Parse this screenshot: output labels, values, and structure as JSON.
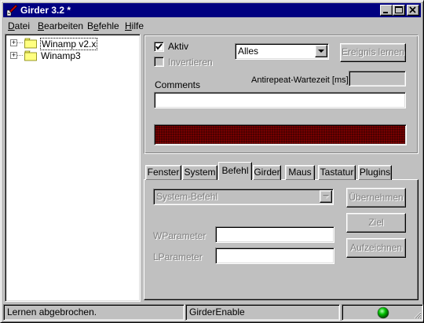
{
  "window": {
    "title": "Girder 3.2 *",
    "icon": "girder-app-icon",
    "controls": {
      "minimize": "minimize-icon",
      "maximize": "maximize-icon",
      "close": "close-icon"
    }
  },
  "menu": {
    "items": [
      {
        "label": "Datei",
        "accel": "D"
      },
      {
        "label": "Bearbeiten",
        "accel": "B"
      },
      {
        "label": "Befehle",
        "accel": "e"
      },
      {
        "label": "Hilfe",
        "accel": "H"
      }
    ]
  },
  "tree": {
    "items": [
      {
        "label": "Winamp v2.x",
        "selected": true,
        "icon": "folder-icon"
      },
      {
        "label": "Winamp3",
        "selected": false,
        "icon": "folder-icon"
      }
    ]
  },
  "event": {
    "aktiv_label": "Aktiv",
    "aktiv_checked": true,
    "invertieren_label": "Invertieren",
    "invertieren_checked": false,
    "filter_value": "Alles",
    "learn_button": "Ereignis lernen",
    "antirepeat_label": "Antirepeat-Wartezeit [ms]",
    "antirepeat_value": "",
    "comments_label": "Comments",
    "comments_value": ""
  },
  "tabs": {
    "items": [
      "Fenster",
      "System",
      "Befehl",
      "Girder",
      "Maus",
      "Tastatur",
      "Plugins"
    ],
    "active": "Befehl"
  },
  "command": {
    "type_value": "System-Befehl",
    "wparam_label": "WParameter",
    "wparam_value": "",
    "lparam_label": "LParameter",
    "lparam_value": "",
    "apply_button": "Übernehmen",
    "target_button": "Ziel",
    "record_button": "Aufzeichnen"
  },
  "status": {
    "message": "Lernen abgebrochen.",
    "command": "GirderEnable",
    "indicator_color": "#00c000"
  },
  "colors": {
    "titlebar": "#000080",
    "display_bg": "#4a0000",
    "display_dot": "#8a0000"
  }
}
